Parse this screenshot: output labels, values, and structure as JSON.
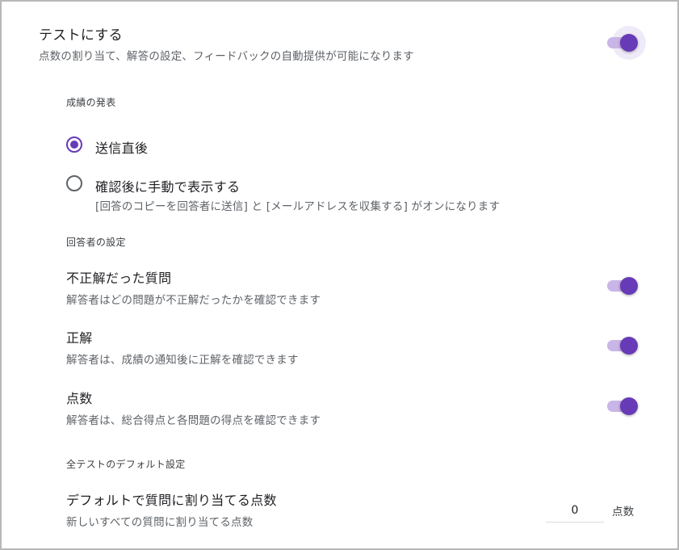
{
  "quiz": {
    "title": "テストにする",
    "description": "点数の割り当て、解答の設定、フィードバックの自動提供が可能になります",
    "enabled": true
  },
  "release_grade": {
    "section_label": "成績の発表",
    "options": [
      {
        "label": "送信直後",
        "selected": true
      },
      {
        "label": "確認後に手動で表示する",
        "selected": false,
        "note": "[回答のコピーを回答者に送信] と [メールアドレスを収集する] がオンになります"
      }
    ]
  },
  "respondent_settings": {
    "section_label": "回答者の設定",
    "items": [
      {
        "title": "不正解だった質問",
        "description": "解答者はどの問題が不正解だったかを確認できます",
        "enabled": true
      },
      {
        "title": "正解",
        "description": "解答者は、成績の通知後に正解を確認できます",
        "enabled": true
      },
      {
        "title": "点数",
        "description": "解答者は、総合得点と各問題の得点を確認できます",
        "enabled": true
      }
    ]
  },
  "defaults": {
    "section_label": "全テストのデフォルト設定",
    "point_value": {
      "title": "デフォルトで質問に割り当てる点数",
      "description": "新しいすべての質問に割り当てる点数",
      "value": "0",
      "unit": "点数"
    }
  },
  "colors": {
    "accent": "#673ab7",
    "track": "#c9b5e6",
    "text": "#202124",
    "secondary": "#5f6368"
  }
}
